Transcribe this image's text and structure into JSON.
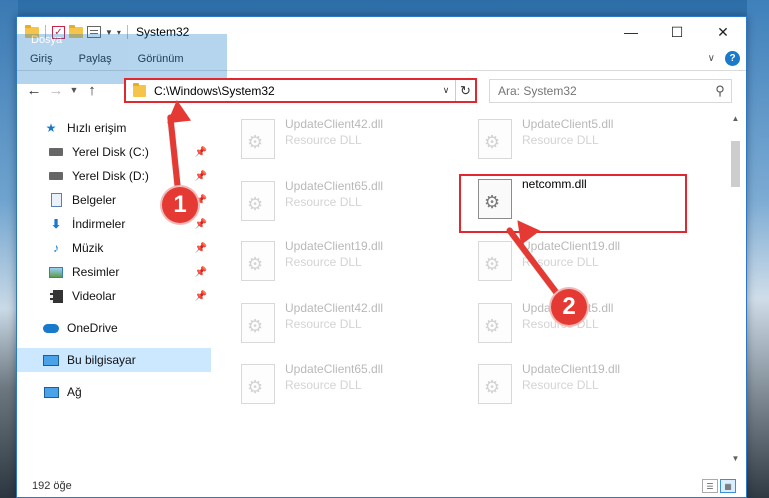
{
  "window": {
    "title": "System32"
  },
  "title_controls": {
    "minimize": "—",
    "maximize": "☐",
    "close": "✕"
  },
  "ribbon": {
    "tabs": [
      "Dosya",
      "Giriş",
      "Paylaş",
      "Görünüm"
    ],
    "help": "?"
  },
  "address": {
    "path": "C:\\Windows\\System32"
  },
  "search": {
    "placeholder": "Ara: System32"
  },
  "sidebar": {
    "quick_access": "Hızlı erişim",
    "items": [
      {
        "label": "Yerel Disk (C:)",
        "icon": "drive-icon",
        "pinned": true
      },
      {
        "label": "Yerel Disk (D:)",
        "icon": "drive-icon",
        "pinned": true
      },
      {
        "label": "Belgeler",
        "icon": "documents-icon",
        "pinned": true
      },
      {
        "label": "İndirmeler",
        "icon": "downloads-icon",
        "pinned": true
      },
      {
        "label": "Müzik",
        "icon": "music-icon",
        "pinned": true
      },
      {
        "label": "Resimler",
        "icon": "pictures-icon",
        "pinned": true
      },
      {
        "label": "Videolar",
        "icon": "videos-icon",
        "pinned": true
      }
    ],
    "onedrive": "OneDrive",
    "this_pc": "Bu bilgisayar",
    "network": "Ağ"
  },
  "files": [
    {
      "name": "UpdateClient42.dll",
      "type": "Resource DLL"
    },
    {
      "name": "UpdateClient5.dll",
      "type": "Resource DLL"
    },
    {
      "name": "UpdateClient65.dll",
      "type": "Resource DLL"
    },
    {
      "name": "netcomm.dll",
      "type": "",
      "highlighted": true
    },
    {
      "name": "UpdateClient19.dll",
      "type": "Resource DLL"
    },
    {
      "name": "UpdateClient19.dll",
      "type": "Resource DLL"
    },
    {
      "name": "UpdateClient42.dll",
      "type": "Resource DLL"
    },
    {
      "name": "UpdateClient5.dll",
      "type": "Resource DLL"
    },
    {
      "name": "UpdateClient65.dll",
      "type": "Resource DLL"
    },
    {
      "name": "UpdateClient19.dll",
      "type": "Resource DLL"
    }
  ],
  "status": {
    "item_count": "192 öğe"
  },
  "annotations": {
    "step1": "1",
    "step2": "2",
    "color": "#e53a34"
  }
}
